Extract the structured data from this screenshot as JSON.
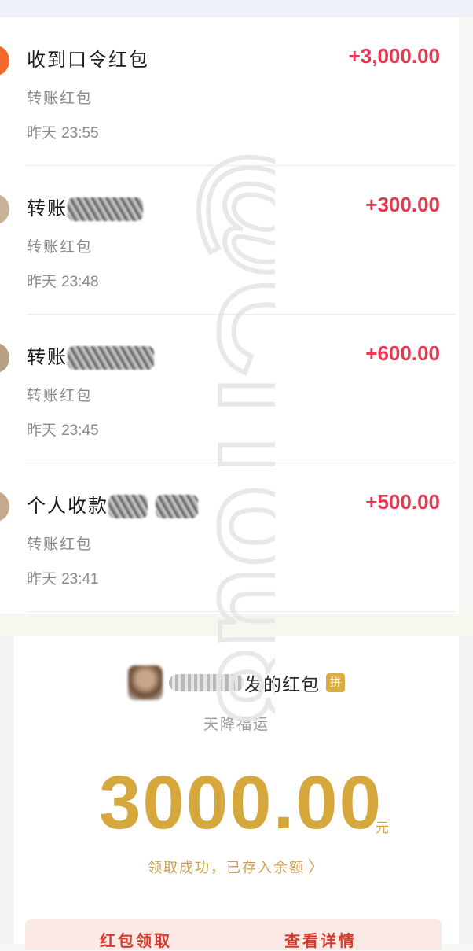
{
  "transactions": [
    {
      "title": "收到口令红包",
      "amount": "+3,000.00",
      "type": "转账红包",
      "time_prefix": "昨天",
      "time": "23:55",
      "avatar_color": "#f26b2c",
      "redacted": false
    },
    {
      "title": "转账",
      "amount": "+300.00",
      "type": "转账红包",
      "time_prefix": "昨天",
      "time": "23:48",
      "avatar_color": "#c9b49a",
      "redacted": true
    },
    {
      "title": "转账",
      "amount": "+600.00",
      "type": "转账红包",
      "time_prefix": "昨天",
      "time": "23:45",
      "avatar_color": "#b8a085",
      "redacted": true
    },
    {
      "title": "个人收款",
      "amount": "+500.00",
      "type": "转账红包",
      "time_prefix": "昨天",
      "time": "23:41",
      "avatar_color": "#c4ab90",
      "redacted": true
    }
  ],
  "envelope": {
    "sender_suffix": "发的红包",
    "badge": "拼",
    "blessing": "天降福运",
    "amount": "3000.00",
    "unit": "元",
    "received_text": "领取成功，已存入余额",
    "received_chevron": "〉",
    "tabs": [
      "红包领取",
      "查看详情"
    ]
  },
  "watermark": "@CiTou8",
  "colors": {
    "amount_red": "#e63950",
    "gold": "#d5a73c",
    "accent_orange": "#f26b2c"
  }
}
